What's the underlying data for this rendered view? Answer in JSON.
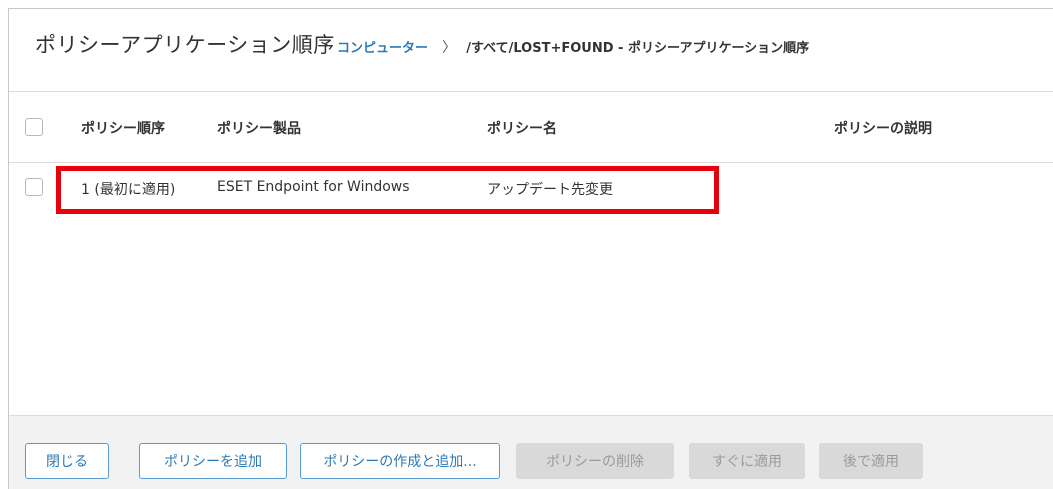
{
  "header": {
    "title": "ポリシーアプリケーション順序",
    "breadcrumb_link": "コンピューター",
    "breadcrumb_separator": "〉",
    "breadcrumb_path": "/すべて/LOST+FOUND - ポリシーアプリケーション順序"
  },
  "table": {
    "columns": [
      "ポリシー順序",
      "ポリシー製品",
      "ポリシー名",
      "ポリシーの説明"
    ],
    "rows": [
      {
        "order": "1 (最初に適用)",
        "product": "ESET Endpoint for Windows",
        "name": "アップデート先変更",
        "description": ""
      }
    ]
  },
  "footer": {
    "buttons": [
      {
        "label": "閉じる",
        "enabled": true
      },
      {
        "label": "ポリシーを追加",
        "enabled": true
      },
      {
        "label": "ポリシーの作成と追加...",
        "enabled": true
      },
      {
        "label": "ポリシーの削除",
        "enabled": false
      },
      {
        "label": "すぐに適用",
        "enabled": false
      },
      {
        "label": "後で適用",
        "enabled": false
      }
    ]
  },
  "colors": {
    "accent": "#2a7ab8",
    "highlight": "#e8000b",
    "disabled_button": "#d9d9d9"
  }
}
